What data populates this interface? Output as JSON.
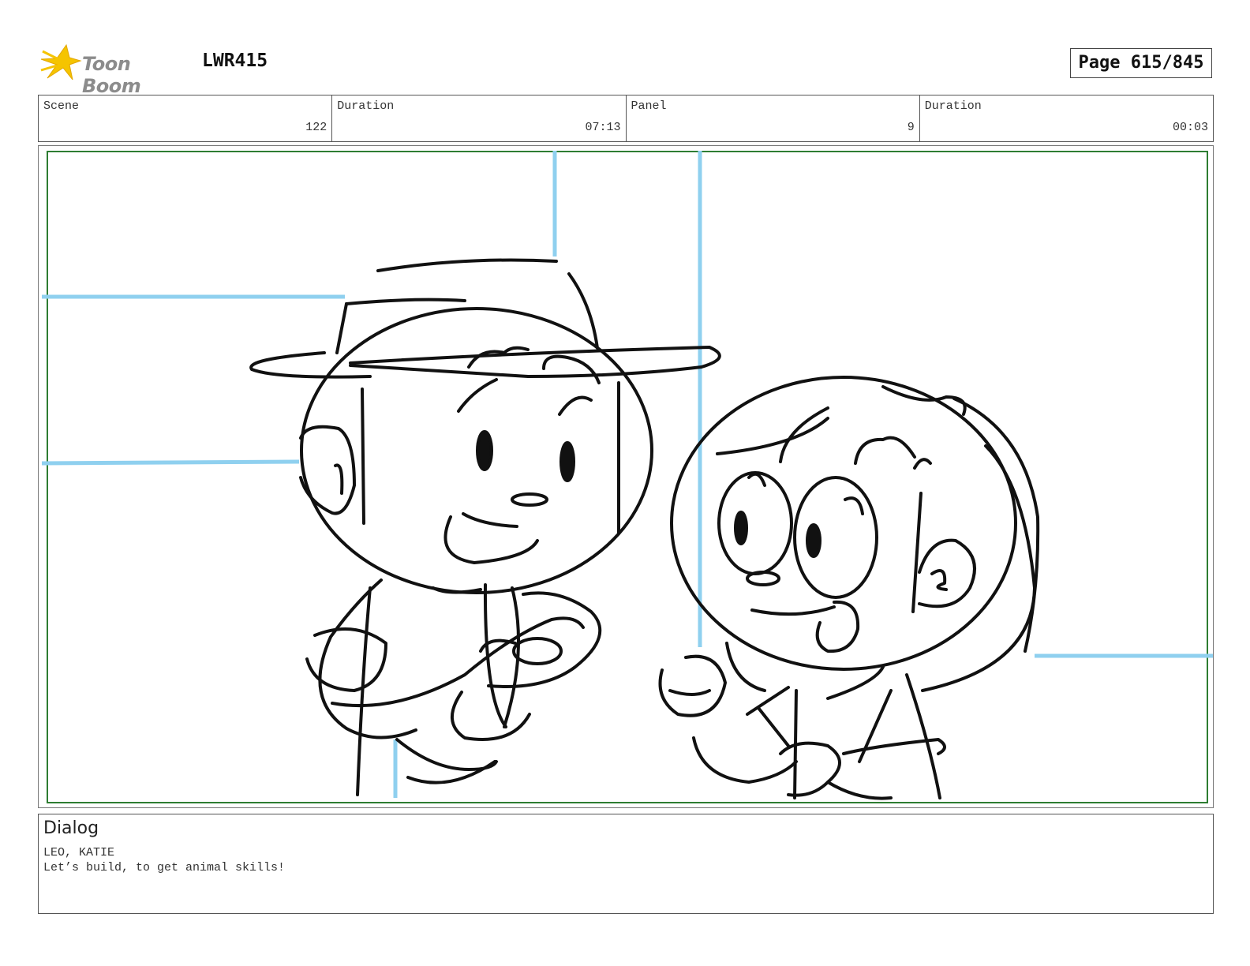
{
  "header": {
    "brand": "Toon Boom",
    "project": "LWR415",
    "page_label": "Page 615/845"
  },
  "info": {
    "scene_label": "Scene",
    "scene_value": "122",
    "duration_label": "Duration",
    "duration_value": "07:13",
    "panel_label": "Panel",
    "panel_value": "9",
    "panel_duration_label": "Duration",
    "panel_duration_value": "00:03"
  },
  "dialog": {
    "title": "Dialog",
    "characters": "LEO, KATIE",
    "line": "Let’s build, to get animal skills!"
  },
  "colors": {
    "safe_frame": "#2e7d32",
    "guide_lines": "#8fd0ef",
    "sketch": "#111111",
    "logo_star": "#f5c400"
  }
}
